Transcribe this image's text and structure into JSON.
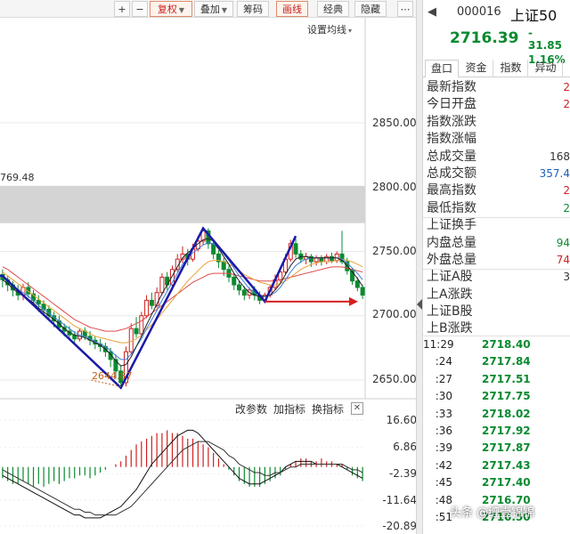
{
  "toolbar": {
    "plus": "+",
    "minus": "−",
    "fuquan": "复权",
    "diejia": "叠加",
    "chouma": "筹码",
    "huaxian": "画线",
    "jingdian": "经典",
    "yincang": "隐藏",
    "more": "⋯",
    "ma_setting": "设置均线"
  },
  "chart_data": [
    {
      "type": "candlestick",
      "title": "",
      "y_axis": {
        "ticks": [
          "2850.00",
          "2800.00",
          "2750.00",
          "2700.00",
          "2650.00"
        ],
        "ylim": [
          2644,
          2880
        ]
      },
      "highlight_band": {
        "from": 2772,
        "to": 2801
      },
      "annotations": {
        "level_label": "769.48",
        "low_label": "2644.87"
      },
      "overlay": {
        "drawn_zigzag": "blue lines: V-W pattern",
        "drawn_arrow": "red horizontal arrow pointing right"
      },
      "candles": [
        [
          2732,
          2728,
          2736,
          2722
        ],
        [
          2728,
          2724,
          2731,
          2719
        ],
        [
          2724,
          2720,
          2727,
          2715
        ],
        [
          2720,
          2716,
          2724,
          2712
        ],
        [
          2716,
          2722,
          2725,
          2712
        ],
        [
          2722,
          2717,
          2726,
          2714
        ],
        [
          2717,
          2712,
          2720,
          2708
        ],
        [
          2712,
          2709,
          2716,
          2703
        ],
        [
          2709,
          2705,
          2712,
          2700
        ],
        [
          2705,
          2700,
          2708,
          2696
        ],
        [
          2700,
          2696,
          2703,
          2691
        ],
        [
          2696,
          2691,
          2700,
          2688
        ],
        [
          2691,
          2688,
          2694,
          2684
        ],
        [
          2688,
          2685,
          2692,
          2681
        ],
        [
          2685,
          2682,
          2688,
          2678
        ],
        [
          2682,
          2688,
          2690,
          2680
        ],
        [
          2688,
          2684,
          2691,
          2681
        ],
        [
          2684,
          2681,
          2688,
          2677
        ],
        [
          2681,
          2678,
          2684,
          2674
        ],
        [
          2678,
          2676,
          2682,
          2672
        ],
        [
          2676,
          2672,
          2679,
          2668
        ],
        [
          2672,
          2666,
          2675,
          2660
        ],
        [
          2666,
          2657,
          2670,
          2651
        ],
        [
          2657,
          2648,
          2661,
          2645
        ],
        [
          2648,
          2672,
          2676,
          2645
        ],
        [
          2672,
          2690,
          2694,
          2670
        ],
        [
          2690,
          2686,
          2699,
          2683
        ],
        [
          2686,
          2700,
          2703,
          2684
        ],
        [
          2700,
          2712,
          2716,
          2698
        ],
        [
          2712,
          2708,
          2718,
          2705
        ],
        [
          2708,
          2718,
          2722,
          2706
        ],
        [
          2718,
          2730,
          2733,
          2716
        ],
        [
          2730,
          2724,
          2734,
          2720
        ],
        [
          2724,
          2736,
          2739,
          2722
        ],
        [
          2736,
          2744,
          2748,
          2734
        ],
        [
          2744,
          2748,
          2754,
          2741
        ],
        [
          2748,
          2744,
          2752,
          2739
        ],
        [
          2744,
          2752,
          2756,
          2742
        ],
        [
          2752,
          2758,
          2762,
          2750
        ],
        [
          2758,
          2766,
          2769,
          2755
        ],
        [
          2766,
          2756,
          2768,
          2752
        ],
        [
          2756,
          2748,
          2759,
          2744
        ],
        [
          2748,
          2742,
          2751,
          2737
        ],
        [
          2742,
          2736,
          2745,
          2731
        ],
        [
          2736,
          2730,
          2739,
          2726
        ],
        [
          2730,
          2724,
          2733,
          2720
        ],
        [
          2724,
          2720,
          2727,
          2716
        ],
        [
          2720,
          2716,
          2723,
          2712
        ],
        [
          2716,
          2720,
          2722,
          2713
        ],
        [
          2720,
          2716,
          2723,
          2712
        ],
        [
          2716,
          2712,
          2719,
          2709
        ],
        [
          2712,
          2716,
          2718,
          2710
        ],
        [
          2716,
          2722,
          2724,
          2714
        ],
        [
          2722,
          2728,
          2732,
          2720
        ],
        [
          2728,
          2734,
          2738,
          2726
        ],
        [
          2734,
          2744,
          2748,
          2732
        ],
        [
          2744,
          2756,
          2759,
          2742
        ],
        [
          2756,
          2748,
          2760,
          2745
        ],
        [
          2748,
          2744,
          2751,
          2741
        ],
        [
          2744,
          2746,
          2749,
          2740
        ],
        [
          2746,
          2742,
          2748,
          2738
        ],
        [
          2742,
          2745,
          2747,
          2739
        ],
        [
          2745,
          2742,
          2747,
          2739
        ],
        [
          2742,
          2746,
          2748,
          2740
        ],
        [
          2746,
          2743,
          2749,
          2741
        ],
        [
          2743,
          2748,
          2750,
          2741
        ],
        [
          2748,
          2742,
          2766,
          2740
        ],
        [
          2742,
          2735,
          2745,
          2732
        ],
        [
          2735,
          2727,
          2737,
          2724
        ],
        [
          2727,
          2722,
          2730,
          2719
        ],
        [
          2722,
          2716,
          2724,
          2713
        ]
      ],
      "series": [
        {
          "name": "",
          "color": "#e04a4a",
          "values": [
            2738,
            2736,
            2733,
            2730,
            2727,
            2724,
            2721,
            2718,
            2715,
            2712,
            2709,
            2706,
            2703,
            2700,
            2697,
            2695,
            2693,
            2691,
            2690,
            2689,
            2688,
            2688,
            2688,
            2689,
            2690,
            2692,
            2694,
            2696,
            2699,
            2702,
            2705,
            2708,
            2711,
            2714,
            2717,
            2720,
            2723,
            2726,
            2728,
            2730,
            2732,
            2733,
            2733,
            2733,
            2733,
            2732,
            2731,
            2730,
            2729,
            2728,
            2727,
            2727,
            2727,
            2727,
            2728,
            2729,
            2730,
            2731,
            2732,
            2733,
            2734,
            2735,
            2736,
            2737,
            2738,
            2738,
            2738,
            2737,
            2736,
            2735,
            2734
          ]
        },
        {
          "name": "",
          "color": "#e8a23a",
          "values": [
            2734,
            2731,
            2728,
            2725,
            2722,
            2719,
            2716,
            2713,
            2710,
            2707,
            2704,
            2701,
            2698,
            2695,
            2692,
            2690,
            2688,
            2686,
            2684,
            2683,
            2682,
            2681,
            2680,
            2679,
            2679,
            2680,
            2682,
            2685,
            2689,
            2693,
            2697,
            2702,
            2707,
            2712,
            2717,
            2722,
            2727,
            2731,
            2735,
            2739,
            2742,
            2743,
            2743,
            2742,
            2740,
            2738,
            2735,
            2732,
            2730,
            2728,
            2726,
            2725,
            2724,
            2724,
            2725,
            2727,
            2730,
            2733,
            2736,
            2738,
            2740,
            2741,
            2742,
            2742,
            2742,
            2743,
            2744,
            2743,
            2742,
            2740,
            2738
          ]
        },
        {
          "name": "",
          "color": "#3f7fdc",
          "values": [
            2730,
            2727,
            2723,
            2720,
            2718,
            2715,
            2712,
            2708,
            2705,
            2702,
            2699,
            2696,
            2693,
            2690,
            2687,
            2685,
            2684,
            2682,
            2680,
            2678,
            2676,
            2673,
            2669,
            2666,
            2666,
            2670,
            2676,
            2682,
            2690,
            2697,
            2704,
            2712,
            2719,
            2726,
            2733,
            2740,
            2745,
            2749,
            2752,
            2755,
            2757,
            2756,
            2752,
            2748,
            2743,
            2737,
            2731,
            2726,
            2721,
            2718,
            2716,
            2715,
            2716,
            2718,
            2722,
            2728,
            2734,
            2739,
            2742,
            2744,
            2745,
            2745,
            2745,
            2745,
            2745,
            2745,
            2744,
            2741,
            2737,
            2733,
            2728
          ]
        },
        {
          "name": "",
          "color": "#222222",
          "values": [
            2728,
            2725,
            2721,
            2718,
            2716,
            2713,
            2710,
            2706,
            2703,
            2700,
            2697,
            2694,
            2690,
            2687,
            2685,
            2684,
            2683,
            2681,
            2679,
            2677,
            2674,
            2670,
            2665,
            2661,
            2662,
            2668,
            2676,
            2684,
            2693,
            2701,
            2709,
            2717,
            2724,
            2731,
            2738,
            2745,
            2749,
            2752,
            2756,
            2759,
            2760,
            2758,
            2752,
            2746,
            2740,
            2733,
            2727,
            2722,
            2718,
            2716,
            2715,
            2715,
            2716,
            2720,
            2725,
            2732,
            2739,
            2744,
            2746,
            2746,
            2745,
            2745,
            2745,
            2745,
            2745,
            2745,
            2743,
            2739,
            2734,
            2729,
            2723
          ]
        }
      ]
    },
    {
      "type": "macd",
      "title": "",
      "y_axis": {
        "ticks": [
          "16.60",
          "6.86",
          "-2.39",
          "-11.64",
          "-20.89"
        ],
        "ylim": [
          -20.89,
          16.6
        ]
      },
      "histogram": [
        -4,
        -5,
        -6,
        -6,
        -5,
        -6,
        -7,
        -6,
        -7,
        -6,
        -5,
        -6,
        -5,
        -4,
        -4,
        -3,
        -3,
        -4,
        -3,
        -2,
        -1,
        0,
        1,
        2,
        4,
        6,
        8,
        9,
        10,
        11,
        12,
        12,
        13,
        12,
        12,
        11,
        10,
        10,
        9,
        8,
        7,
        5,
        3,
        1,
        -1,
        -3,
        -5,
        -6,
        -7,
        -7,
        -7,
        -6,
        -5,
        -4,
        -3,
        -1,
        1,
        2,
        3,
        3,
        2,
        2,
        3,
        2,
        2,
        1,
        1,
        -1,
        -3,
        -4,
        -5
      ],
      "dif": [
        -3,
        -4,
        -5,
        -6,
        -7,
        -8,
        -9,
        -10,
        -11,
        -12,
        -13,
        -14,
        -15,
        -16,
        -17,
        -17,
        -18,
        -18,
        -18,
        -18,
        -17,
        -16,
        -15,
        -14,
        -12,
        -10,
        -8,
        -5,
        -2,
        1,
        3,
        5,
        7,
        9,
        11,
        12,
        13,
        13,
        12,
        10,
        8,
        6,
        4,
        2,
        0,
        -2,
        -4,
        -5,
        -6,
        -6,
        -6,
        -5,
        -4,
        -3,
        -2,
        0,
        1,
        2,
        2,
        2,
        2,
        1,
        1,
        1,
        1,
        1,
        0,
        -1,
        -2,
        -3,
        -4
      ],
      "dea": [
        -1,
        -2,
        -3,
        -4,
        -5,
        -6,
        -7,
        -8,
        -9,
        -10,
        -11,
        -12,
        -13,
        -14,
        -15,
        -15,
        -16,
        -16,
        -17,
        -17,
        -17,
        -17,
        -17,
        -16,
        -15,
        -14,
        -12,
        -10,
        -8,
        -6,
        -4,
        -2,
        0,
        2,
        4,
        6,
        7,
        8,
        9,
        9,
        9,
        8,
        7,
        6,
        4,
        3,
        1,
        0,
        -1,
        -2,
        -2,
        -3,
        -3,
        -2,
        -2,
        -1,
        0,
        0,
        1,
        1,
        1,
        1,
        1,
        1,
        1,
        1,
        1,
        0,
        -1,
        -1,
        -2
      ]
    }
  ],
  "macd_tools": {
    "params": "改参数",
    "add_indicator": "加指标",
    "switch_indicator": "换指标",
    "close": "✕"
  },
  "panel": {
    "back": "◀",
    "code": "000016",
    "name": "上证50",
    "price": "2716.39",
    "change": "- 31.85",
    "change_pct": "- 1.16%",
    "tabs": [
      "盘口",
      "资金",
      "指数",
      "异动"
    ],
    "stats": [
      {
        "label": "最新指数",
        "value": "2",
        "color": "#d02020"
      },
      {
        "label": "今日开盘",
        "value": "2",
        "color": "#d02020"
      },
      {
        "label": "指数涨跌",
        "value": "",
        "color": "#0a8a30"
      },
      {
        "label": "指数涨幅",
        "value": "",
        "color": "#333333"
      },
      {
        "label": "总成交量",
        "value": "168",
        "color": "#333333"
      },
      {
        "label": "总成交额",
        "value": "357.4",
        "color": "#1b5fb8"
      },
      {
        "label": "最高指数",
        "value": "2",
        "color": "#d02020"
      },
      {
        "label": "最低指数",
        "value": "2",
        "color": "#0a8a30"
      },
      {
        "label": "上证换手",
        "value": "",
        "color": "#333333"
      },
      {
        "label": "内盘总量",
        "value": "94",
        "color": "#0a8a30"
      },
      {
        "label": "外盘总量",
        "value": "74",
        "color": "#d02020"
      },
      {
        "label": "上证A股",
        "value": "3",
        "color": "#333333"
      },
      {
        "label": "上A涨跌",
        "value": "",
        "color": "#0a8a30"
      },
      {
        "label": "上证B股",
        "value": "",
        "color": "#333333"
      },
      {
        "label": "上B涨跌",
        "value": "",
        "color": "#333333"
      }
    ],
    "ticks": [
      {
        "time": "11:29",
        "price": "2718.40"
      },
      {
        "time": ":24",
        "price": "2717.84"
      },
      {
        "time": ":27",
        "price": "2717.51"
      },
      {
        "time": ":30",
        "price": "2717.75"
      },
      {
        "time": ":33",
        "price": "2718.02"
      },
      {
        "time": ":36",
        "price": "2717.92"
      },
      {
        "time": ":39",
        "price": "2717.87"
      },
      {
        "time": ":42",
        "price": "2717.43"
      },
      {
        "time": ":45",
        "price": "2717.40"
      },
      {
        "time": ":48",
        "price": "2716.70"
      },
      {
        "time": ":51",
        "price": "2716.50"
      }
    ]
  },
  "watermark": "头条 @缠壹锦锦",
  "colors": {
    "up": "#d02020",
    "down": "#0a8a30",
    "band": "#d4d4d4",
    "zigzag": "#1a1aa8",
    "arrow": "#d42020"
  }
}
